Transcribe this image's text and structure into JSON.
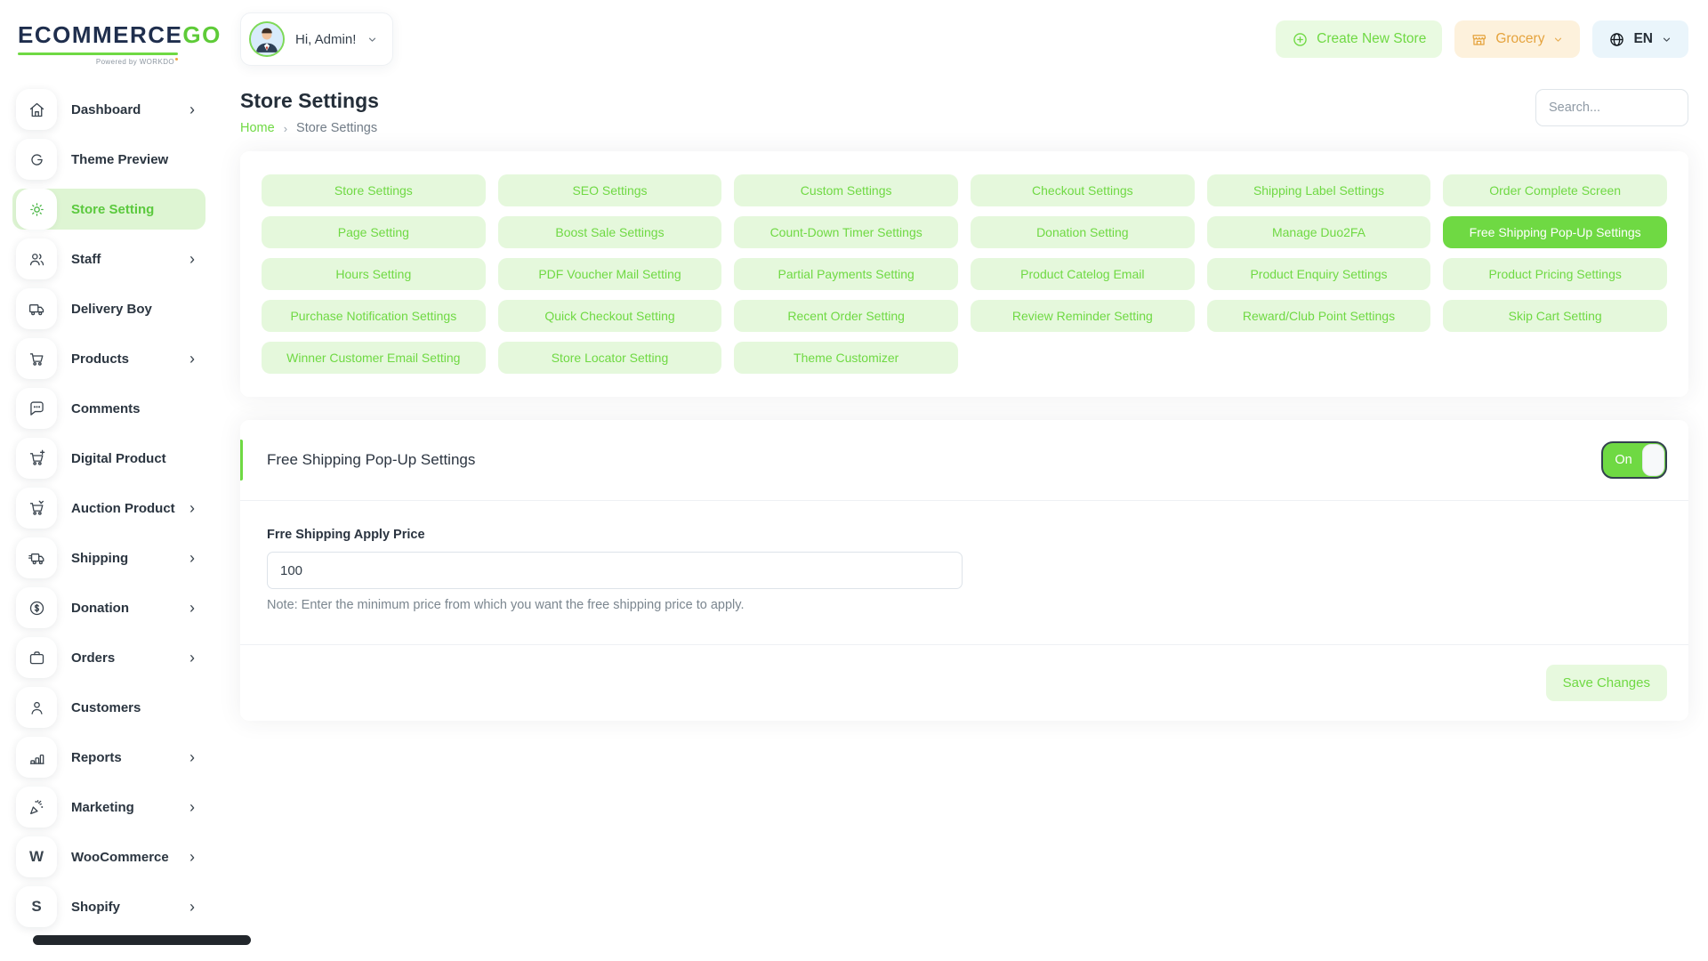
{
  "brand": {
    "name_primary": "ECOMMERCE",
    "name_secondary": "GO",
    "powered_by": "Powered by WORKDO"
  },
  "header": {
    "greeting": "Hi, Admin!",
    "create_store_label": "Create New Store",
    "store_selector_label": "Grocery",
    "language_label": "EN"
  },
  "sidebar": {
    "items": [
      {
        "label": "Dashboard",
        "icon": "home-icon",
        "chevron": true,
        "active": false
      },
      {
        "label": "Theme Preview",
        "icon": "theme-preview-icon",
        "chevron": false,
        "active": false
      },
      {
        "label": "Store Setting",
        "icon": "gear-icon",
        "chevron": false,
        "active": true
      },
      {
        "label": "Staff",
        "icon": "staff-icon",
        "chevron": true,
        "active": false
      },
      {
        "label": "Delivery Boy",
        "icon": "delivery-truck-icon",
        "chevron": false,
        "active": false
      },
      {
        "label": "Products",
        "icon": "cart-icon",
        "chevron": true,
        "active": false
      },
      {
        "label": "Comments",
        "icon": "comment-icon",
        "chevron": false,
        "active": false
      },
      {
        "label": "Digital Product",
        "icon": "digital-cart-icon",
        "chevron": false,
        "active": false
      },
      {
        "label": "Auction Product",
        "icon": "auction-cart-icon",
        "chevron": true,
        "active": false
      },
      {
        "label": "Shipping",
        "icon": "shipping-truck-icon",
        "chevron": true,
        "active": false
      },
      {
        "label": "Donation",
        "icon": "dollar-circle-icon",
        "chevron": true,
        "active": false
      },
      {
        "label": "Orders",
        "icon": "briefcase-icon",
        "chevron": true,
        "active": false
      },
      {
        "label": "Customers",
        "icon": "person-icon",
        "chevron": false,
        "active": false
      },
      {
        "label": "Reports",
        "icon": "bar-chart-icon",
        "chevron": true,
        "active": false
      },
      {
        "label": "Marketing",
        "icon": "marketing-icon",
        "chevron": true,
        "active": false
      },
      {
        "label": "WooCommerce",
        "icon": "woocommerce-icon",
        "chevron": true,
        "active": false
      },
      {
        "label": "Shopify",
        "icon": "shopify-icon",
        "chevron": true,
        "active": false
      }
    ]
  },
  "page": {
    "title": "Store Settings",
    "breadcrumb": [
      {
        "label": "Home"
      },
      {
        "label": "Store Settings"
      }
    ],
    "breadcrumb_separator": "›",
    "search_placeholder": "Search..."
  },
  "settings_nav": {
    "items": [
      {
        "label": "Store Settings",
        "active": false
      },
      {
        "label": "SEO Settings",
        "active": false
      },
      {
        "label": "Custom Settings",
        "active": false
      },
      {
        "label": "Checkout Settings",
        "active": false
      },
      {
        "label": "Shipping Label Settings",
        "active": false
      },
      {
        "label": "Order Complete Screen",
        "active": false
      },
      {
        "label": "Page Setting",
        "active": false
      },
      {
        "label": "Boost Sale Settings",
        "active": false
      },
      {
        "label": "Count-Down Timer Settings",
        "active": false
      },
      {
        "label": "Donation Setting",
        "active": false
      },
      {
        "label": "Manage Duo2FA",
        "active": false
      },
      {
        "label": "Free Shipping Pop-Up Settings",
        "active": true
      },
      {
        "label": "Hours Setting",
        "active": false
      },
      {
        "label": "PDF Voucher Mail Setting",
        "active": false
      },
      {
        "label": "Partial Payments Setting",
        "active": false
      },
      {
        "label": "Product Catelog Email",
        "active": false
      },
      {
        "label": "Product Enquiry Settings",
        "active": false
      },
      {
        "label": "Product Pricing Settings",
        "active": false
      },
      {
        "label": "Purchase Notification Settings",
        "active": false
      },
      {
        "label": "Quick Checkout Setting",
        "active": false
      },
      {
        "label": "Recent Order Setting",
        "active": false
      },
      {
        "label": "Review Reminder Setting",
        "active": false
      },
      {
        "label": "Reward/Club Point Settings",
        "active": false
      },
      {
        "label": "Skip Cart Setting",
        "active": false
      },
      {
        "label": "Winner Customer Email Setting",
        "active": false
      },
      {
        "label": "Store Locator Setting",
        "active": false
      },
      {
        "label": "Theme Customizer",
        "active": false
      }
    ]
  },
  "panel": {
    "title": "Free Shipping Pop-Up Settings",
    "toggle_state": "on",
    "toggle_label": "On",
    "field_label": "Frre Shipping Apply Price",
    "field_value": "100",
    "note": "Note: Enter the minimum price from which you want the free shipping price to apply.",
    "save_label": "Save Changes"
  },
  "colors": {
    "accent_green": "#6fd943",
    "light_green_bg": "#e5f8dc",
    "active_nav_bg": "#def5d3",
    "store_btn_orange": "#e5a33d",
    "store_btn_bg": "#fdf1dc",
    "lang_btn_bg": "#eaf5fb",
    "text_dark": "#242e39",
    "text_muted": "#7b868f"
  }
}
